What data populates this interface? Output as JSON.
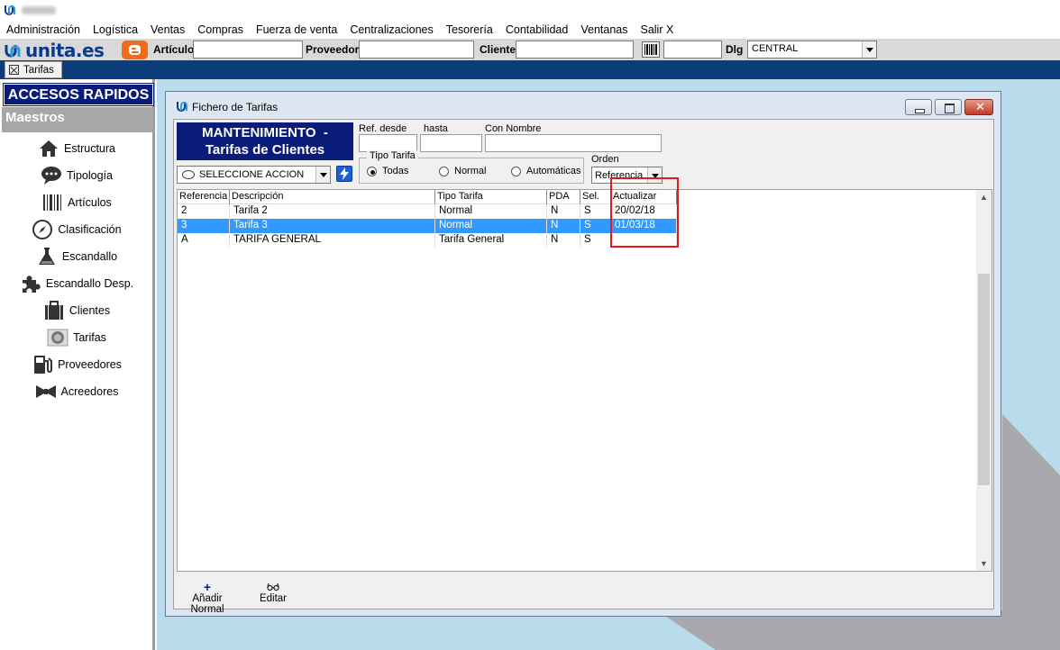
{
  "app": {
    "brand": "unita.es"
  },
  "menu": [
    "Administración",
    "Logística",
    "Ventas",
    "Compras",
    "Fuerza de venta",
    "Centralizaciones",
    "Tesorería",
    "Contabilidad",
    "Ventanas",
    "Salir X"
  ],
  "toolbar": {
    "articulo_label": "Artículo",
    "articulo_value": "",
    "proveedor_label": "Proveedor",
    "proveedor_value": "",
    "cliente_label": "Cliente",
    "cliente_value": "",
    "barcode_value": "",
    "dlg_label": "Dlg",
    "dlg_value": "CENTRAL"
  },
  "tabs": [
    {
      "label": "Tarifas"
    }
  ],
  "sidebar": {
    "header": "ACCESOS RAPIDOS",
    "section": "Maestros",
    "items": [
      {
        "label": "Estructura",
        "icon": "house-icon"
      },
      {
        "label": "Tipología",
        "icon": "chat-bubbles-icon"
      },
      {
        "label": "Artículos",
        "icon": "barcode-icon"
      },
      {
        "label": "Clasificación",
        "icon": "compass-icon"
      },
      {
        "label": "Escandallo",
        "icon": "flask-icon"
      },
      {
        "label": "Escandallo Desp.",
        "icon": "puzzle-icon"
      },
      {
        "label": "Clientes",
        "icon": "briefcase-icon"
      },
      {
        "label": "Tarifas",
        "icon": "coin-icon"
      },
      {
        "label": "Proveedores",
        "icon": "fuel-pump-icon"
      },
      {
        "label": "Acreedores",
        "icon": "bowtie-icon"
      }
    ]
  },
  "window": {
    "title": "Fichero de Tarifas",
    "header_line1": "MANTENIMIENTO  -",
    "header_line2": "Tarifas de Clientes",
    "action_select": "SELECCIONE ACCION",
    "ref_desde_label": "Ref. desde",
    "ref_desde_value": "",
    "hasta_label": "hasta",
    "hasta_value": "",
    "con_nombre_label": "Con Nombre",
    "con_nombre_value": "",
    "tipo_tarifa_label": "Tipo Tarifa",
    "tipo_options": [
      {
        "label": "Todas",
        "selected": true
      },
      {
        "label": "Normal",
        "selected": false
      },
      {
        "label": "Automáticas",
        "selected": false
      }
    ],
    "orden_label": "Orden",
    "orden_value": "Referencia"
  },
  "grid": {
    "columns": [
      "Referencia",
      "Descripción",
      "Tipo Tarifa",
      "PDA",
      "Sel.",
      "Actualizar"
    ],
    "rows": [
      {
        "cells": [
          "2",
          "Tarifa 2",
          "Normal",
          "N",
          "S",
          "20/02/18"
        ],
        "selected": false
      },
      {
        "cells": [
          "3",
          "Tarifa 3",
          "Normal",
          "N",
          "S",
          "01/03/18"
        ],
        "selected": true
      },
      {
        "cells": [
          "A",
          "TARIFA GENERAL",
          "Tarifa General",
          "N",
          "S",
          ""
        ],
        "selected": false
      }
    ]
  },
  "bottom_actions": [
    {
      "label": "Añadir Normal",
      "icon": "plus-icon"
    },
    {
      "label": "Editar",
      "icon": "glasses-icon"
    }
  ],
  "colors": {
    "accent_navy": "#0a1c7a",
    "tabstrip": "#0a3d7a",
    "selection": "#3399ff",
    "highlight_red": "#e01b1b",
    "desktop": "#b9dcec"
  }
}
